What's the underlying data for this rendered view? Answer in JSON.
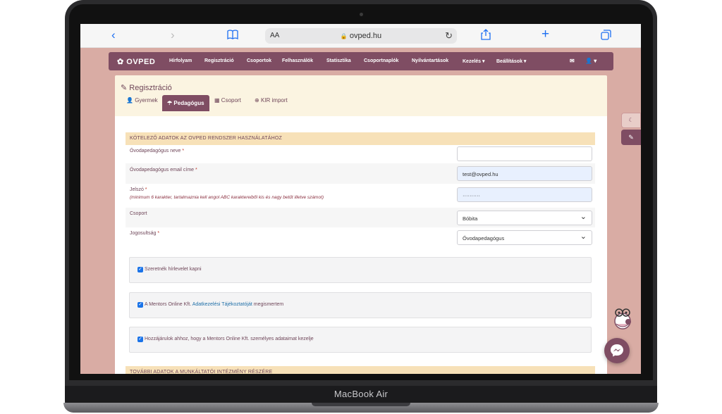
{
  "device": {
    "brand": "MacBook Air"
  },
  "browser": {
    "text_size": "AA",
    "url": "ovped.hu"
  },
  "navbar": {
    "logo": "OVPED",
    "items": [
      "Hírfolyam",
      "Regisztráció",
      "Csoportok",
      "Felhasználók",
      "Statisztika",
      "Csoportnaplók",
      "Nyilvántartások",
      "Kezelés ▾",
      "Beállítások ▾"
    ],
    "user_menu": "▾"
  },
  "page": {
    "title": "Regisztráció",
    "tabs": [
      {
        "label": "Gyermek",
        "active": false
      },
      {
        "label": "Pedagógus",
        "active": true
      },
      {
        "label": "Csoport",
        "active": false
      },
      {
        "label": "KIR import",
        "active": false
      }
    ]
  },
  "form": {
    "section_required": "KÖTELEZŐ ADATOK AZ OVPED RENDSZER HASZNÁLATÁHOZ",
    "fields": {
      "name": {
        "label": "Óvodapedagógus neve",
        "value": ""
      },
      "email": {
        "label": "Óvodapedagógus email címe",
        "value": "test@ovped.hu"
      },
      "password": {
        "label": "Jelszó",
        "hint": "(minimum 6 karakter, tartalmaznia kell angol ABC karaktereiből kis és nagy betűt illetve számot)",
        "value": "··········"
      },
      "group": {
        "label": "Csoport",
        "value": "Bóbita"
      },
      "role": {
        "label": "Jogosultság",
        "value": "Óvodapedagógus"
      }
    },
    "required_mark": "*",
    "checkboxes": {
      "newsletter": "Szeretnék hírlevelet kapni",
      "privacy_prefix": "A Mentors Online Kft.",
      "privacy_link": "Adatkezelési Tájékoztatóját",
      "privacy_suffix": "megismertem",
      "consent": "Hozzájárulok ahhoz, hogy a Mentors Online Kft. személyes adataimat kezelje"
    },
    "section_optional": "TOVÁBBI ADATOK A MUNKÁLTATÓI INTÉZMÉNY RÉSZÉRE"
  },
  "colors": {
    "brand": "#7f4d63",
    "page_bg": "#d9aca4",
    "section_bg": "#f7e1b8",
    "card_bg": "#fbf4e1"
  }
}
